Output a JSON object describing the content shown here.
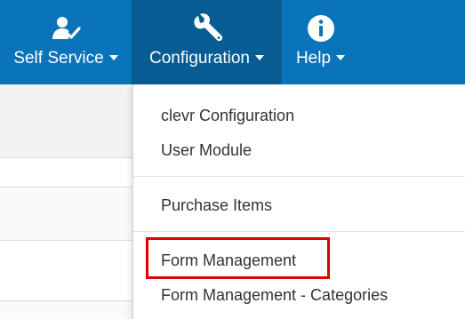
{
  "navbar": {
    "items": [
      {
        "label": "Self Service",
        "icon": "user-check-icon",
        "active": false
      },
      {
        "label": "Configuration",
        "icon": "wrench-icon",
        "active": true
      },
      {
        "label": "Help",
        "icon": "info-icon",
        "active": false
      }
    ]
  },
  "config_menu": {
    "items": [
      {
        "label": "clevr Configuration"
      },
      {
        "label": "User Module"
      },
      {
        "label": "Purchase Items"
      },
      {
        "label": "Form Management",
        "highlighted": true
      },
      {
        "label": "Form Management - Categories"
      }
    ]
  },
  "colors": {
    "navbar": "#0a74bb",
    "navbar_active": "#075c94",
    "highlight": "#e00000",
    "menu_text": "#333333"
  }
}
